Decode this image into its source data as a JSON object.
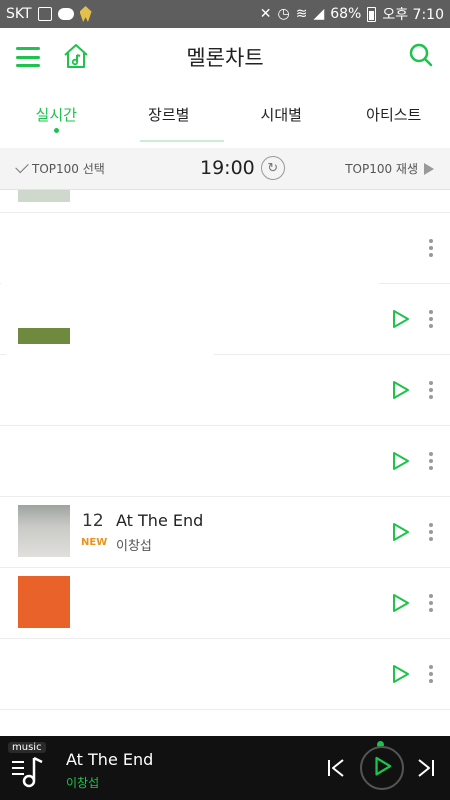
{
  "status_bar": {
    "carrier": "SKT",
    "battery": "68%",
    "time": "오후 7:10"
  },
  "header": {
    "title": "멜론차트",
    "menu_icon": "hamburger-menu-icon",
    "home_icon": "home-music-icon",
    "search_icon": "search-icon"
  },
  "tabs": [
    {
      "label": "실시간",
      "active": true
    },
    {
      "label": "장르별",
      "active": false
    },
    {
      "label": "시대별",
      "active": false
    },
    {
      "label": "아티스트",
      "active": false
    }
  ],
  "toolbar": {
    "select_label": "TOP100 선택",
    "time": "19:00",
    "play_label": "TOP100 재생"
  },
  "chart_rows": [
    {
      "rank": "12",
      "title": "At The End",
      "artist": "이창섭",
      "badge": "NEW"
    }
  ],
  "player": {
    "tag": "music",
    "title": "At The End",
    "artist": "이창섭"
  },
  "colors": {
    "accent": "#1ec34c",
    "new_badge": "#e8941e",
    "player_bg": "#111111"
  }
}
